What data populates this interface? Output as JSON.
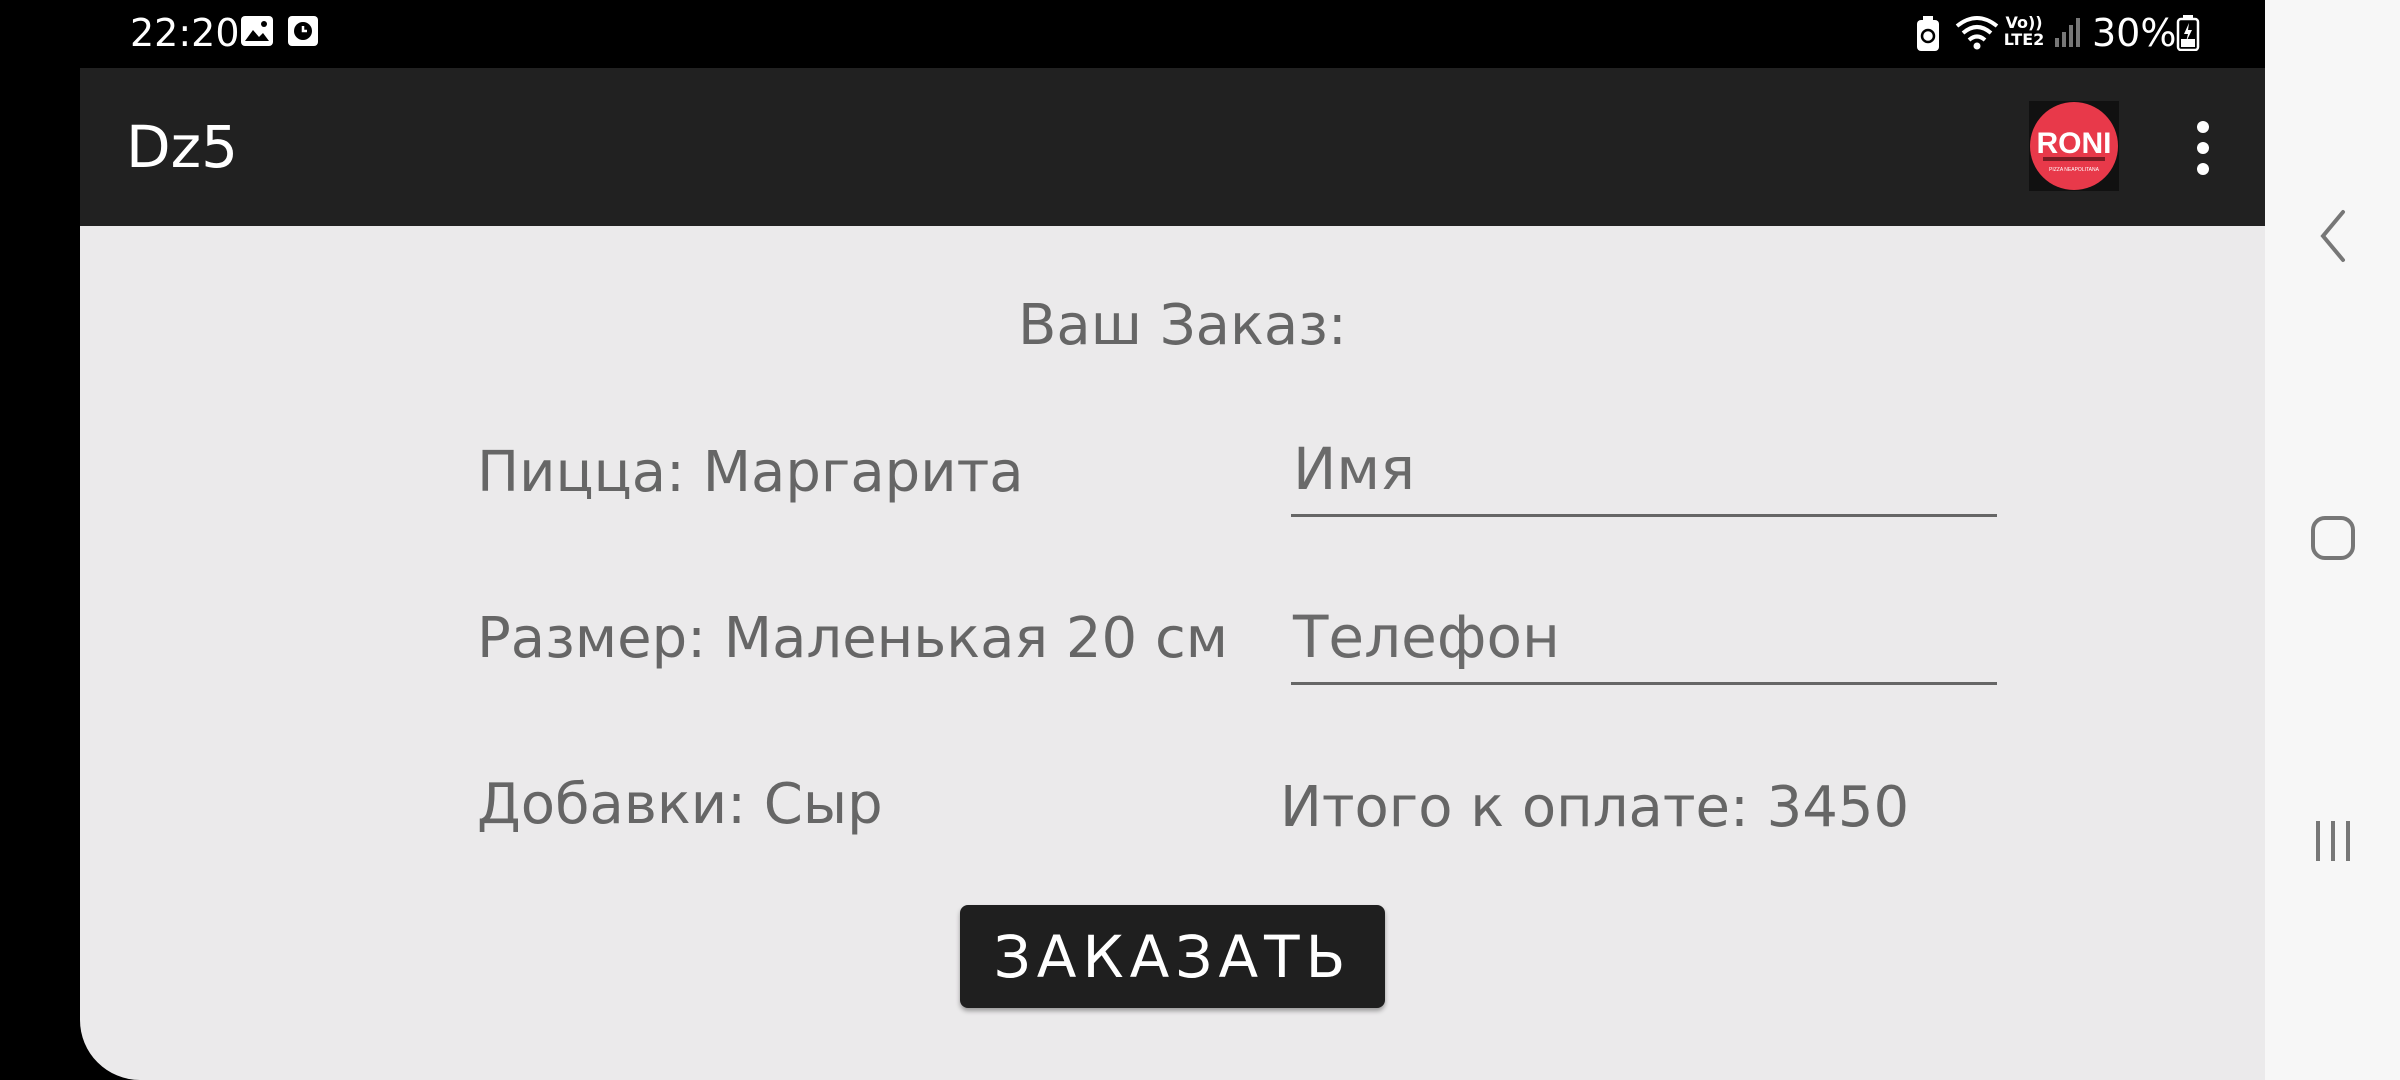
{
  "status_bar": {
    "time": "22:20",
    "battery": "30%",
    "network": "VoLTE2",
    "icons": [
      "image-icon",
      "clock-app-icon",
      "battery-saver-icon",
      "wifi-icon",
      "signal-icon",
      "battery-icon"
    ]
  },
  "toolbar": {
    "title": "Dz5",
    "logo_text": "RONI",
    "logo_sub": "PIZZA NEAPOLITANA",
    "logo_color": "#e8394a"
  },
  "order": {
    "heading": "Ваш Заказ:",
    "pizza": "Пицца: Маргарита",
    "size": "Размер: Маленькая 20 см",
    "extras": "Добавки: Сыр",
    "total": "Итого к оплате: 3450"
  },
  "form": {
    "name_placeholder": "Имя",
    "phone_placeholder": "Телефон"
  },
  "button": {
    "order_label": "ЗАКАЗАТЬ"
  },
  "nav_bar": {
    "icons": [
      "back-icon",
      "home-icon",
      "recents-icon"
    ]
  },
  "colors": {
    "toolbar": "#212121",
    "background": "#ebeaeb",
    "text": "#666666",
    "button": "#1f1f1f"
  }
}
